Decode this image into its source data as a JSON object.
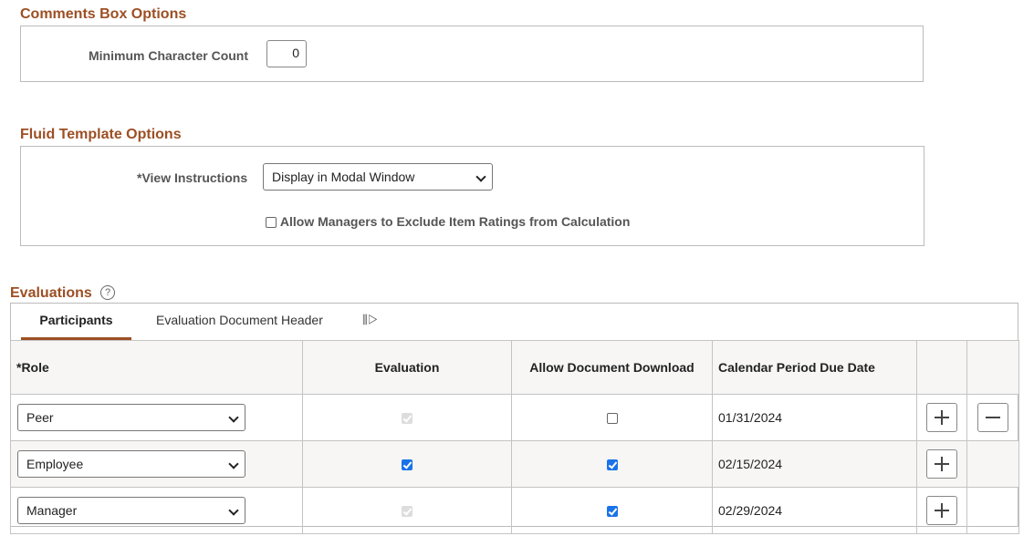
{
  "comments": {
    "title": "Comments Box Options",
    "min_label": "Minimum Character Count",
    "min_value": "0"
  },
  "fluid": {
    "title": "Fluid Template Options",
    "view_label": "*View Instructions",
    "view_value": "Display in Modal Window",
    "exclude_label": "Allow Managers to Exclude Item Ratings from Calculation",
    "exclude_checked": false
  },
  "evaluations": {
    "title": "Evaluations",
    "tabs": [
      "Participants",
      "Evaluation Document Header"
    ],
    "headers": [
      "*Role",
      "Evaluation",
      "Allow Document Download",
      "Calendar Period Due Date"
    ],
    "rows": [
      {
        "role": "Peer",
        "evaluation": "disabled-checked",
        "download": "unchecked",
        "date": "01/31/2024"
      },
      {
        "role": "Employee",
        "evaluation": "checked",
        "download": "checked",
        "date": "02/15/2024"
      },
      {
        "role": "Manager",
        "evaluation": "disabled-checked",
        "download": "checked",
        "date": "02/29/2024"
      }
    ]
  }
}
